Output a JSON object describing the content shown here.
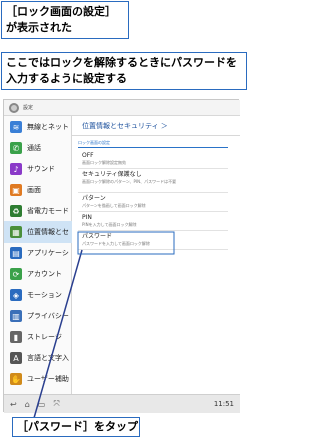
{
  "callouts": {
    "top_line1": "［ロック画面の設定］",
    "top_line2": "が表示された",
    "middle": "ここではロックを解除するときにパスワードを入力するように設定する",
    "bottom": "［パスワード］をタップ"
  },
  "screen": {
    "status_title": "設定",
    "sidebar": [
      {
        "label": "無線とネット",
        "icon": "wifi-icon",
        "color": "#3a7fd6",
        "glyph": "≋"
      },
      {
        "label": "通話",
        "icon": "phone-icon",
        "color": "#3aa14a",
        "glyph": "✆"
      },
      {
        "label": "サウンド",
        "icon": "speaker-icon",
        "color": "#8a3ac8",
        "glyph": "♪"
      },
      {
        "label": "画面",
        "icon": "display-icon",
        "color": "#e07a22",
        "glyph": "▣"
      },
      {
        "label": "省電力モード",
        "icon": "battery-icon",
        "color": "#2e7d32",
        "glyph": "♻"
      },
      {
        "label": "位置情報とセ",
        "icon": "location-grid-icon",
        "color": "#4a8f3a",
        "glyph": "▦"
      },
      {
        "label": "アプリケーシ",
        "icon": "apps-icon",
        "color": "#2a6bbf",
        "glyph": "▤"
      },
      {
        "label": "アカウント",
        "icon": "sync-icon",
        "color": "#3aa14a",
        "glyph": "⟳"
      },
      {
        "label": "モーション",
        "icon": "motion-icon",
        "color": "#2a6bbf",
        "glyph": "◈"
      },
      {
        "label": "プライバシー",
        "icon": "privacy-icon",
        "color": "#3a6fb8",
        "glyph": "▥"
      },
      {
        "label": "ストレージ",
        "icon": "storage-icon",
        "color": "#666666",
        "glyph": "▮"
      },
      {
        "label": "言語と文字入",
        "icon": "keyboard-icon",
        "color": "#555555",
        "glyph": "A"
      },
      {
        "label": "ユーザー補助",
        "icon": "accessibility-icon",
        "color": "#d08a1a",
        "glyph": "✋"
      }
    ],
    "content_header": "位置情報とセキュリティ ＞",
    "section_head": "ロック画面の設定",
    "options": [
      {
        "title": "OFF",
        "desc": "画面ロック解除設定無効"
      },
      {
        "title": "セキュリティ保護なし",
        "desc": "画面ロック解除のパターン、PIN、パスワードは不要"
      },
      {
        "title": "パターン",
        "desc": "パターンを描画して画面ロック解除"
      },
      {
        "title": "PIN",
        "desc": "PINを入力して画面ロック解除"
      },
      {
        "title": "パスワード",
        "desc": "パスワードを入力して画面ロック解除"
      }
    ],
    "time": "11:51"
  }
}
